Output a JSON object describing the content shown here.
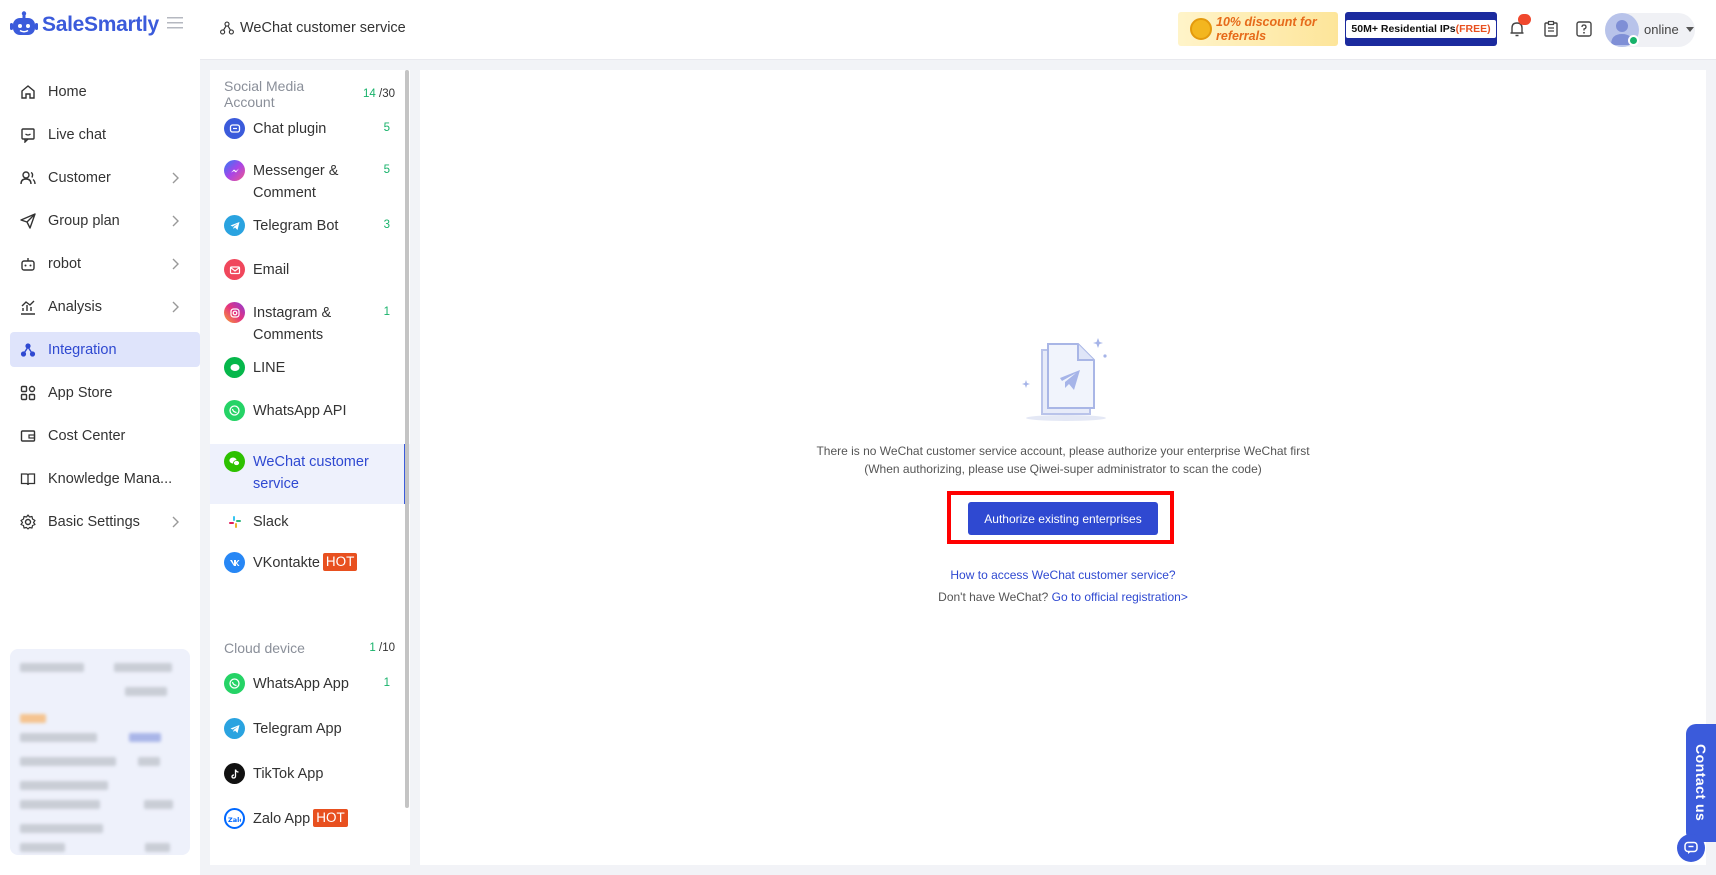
{
  "app": {
    "name": "SaleSmartly"
  },
  "header": {
    "breadcrumb": "WeChat customer service",
    "banner_referral": "10% discount for referrals",
    "banner_ip_main": "50M+ Residential IPs",
    "banner_ip_free": "(FREE)",
    "status": "online"
  },
  "sidebar": {
    "items": [
      {
        "label": "Home",
        "icon": "home-icon"
      },
      {
        "label": "Live chat",
        "icon": "chat-icon"
      },
      {
        "label": "Customer",
        "icon": "users-icon"
      },
      {
        "label": "Group plan",
        "icon": "send-icon"
      },
      {
        "label": "robot",
        "icon": "robot-icon"
      },
      {
        "label": "Analysis",
        "icon": "chart-icon"
      },
      {
        "label": "Integration",
        "icon": "integration-icon"
      },
      {
        "label": "App Store",
        "icon": "apps-icon"
      },
      {
        "label": "Cost Center",
        "icon": "wallet-icon"
      },
      {
        "label": "Knowledge Mana...",
        "icon": "book-icon"
      },
      {
        "label": "Basic Settings",
        "icon": "gear-icon"
      }
    ]
  },
  "subpanel": {
    "social": {
      "title": "Social Media Account",
      "count_used": "14",
      "count_total": "/30",
      "items": [
        {
          "label": "Chat plugin",
          "badge": "5"
        },
        {
          "label": "Messenger & Comment",
          "badge": "5"
        },
        {
          "label": "Telegram Bot",
          "badge": "3"
        },
        {
          "label": "Email",
          "badge": ""
        },
        {
          "label": "Instagram & Comments",
          "badge": "1"
        },
        {
          "label": "LINE",
          "badge": ""
        },
        {
          "label": "WhatsApp API",
          "badge": ""
        },
        {
          "label": "WeChat customer service",
          "badge": ""
        },
        {
          "label": "Slack",
          "badge": ""
        },
        {
          "label": "VKontakte",
          "badge": "",
          "hot": "HOT"
        }
      ]
    },
    "cloud": {
      "title": "Cloud device",
      "count_used": "1",
      "count_total": "/10",
      "items": [
        {
          "label": "WhatsApp App",
          "badge": "1"
        },
        {
          "label": "Telegram App",
          "badge": ""
        },
        {
          "label": "TikTok App",
          "badge": ""
        },
        {
          "label": "Zalo App",
          "badge": "",
          "hot": "HOT"
        }
      ]
    }
  },
  "main": {
    "empty_line1": "There is no WeChat customer service account, please authorize your enterprise WeChat first",
    "empty_line2": "(When authorizing, please use Qiwei-super administrator to scan the code)",
    "authorize_button": "Authorize existing enterprises",
    "help_link": "How to access WeChat customer service?",
    "no_wechat": "Don't have WeChat?",
    "register_link": "Go to official registration>"
  },
  "contact": {
    "label": "Contact us"
  },
  "colors": {
    "accent": "#3b5bdb",
    "active_bg": "#dfe4fb",
    "success": "#17b26a",
    "hot": "#e8501f",
    "highlight": "#ff0000"
  }
}
